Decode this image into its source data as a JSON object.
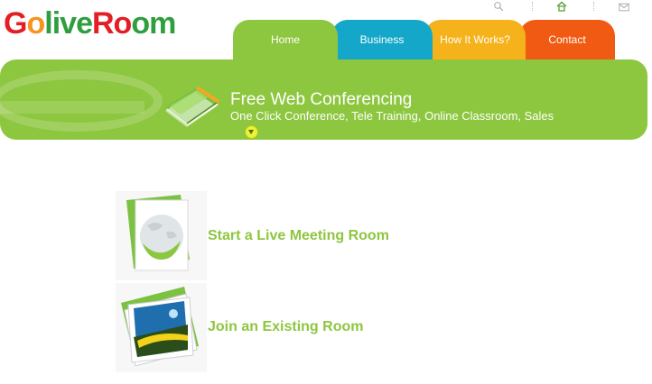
{
  "brand": {
    "logo_letters": [
      {
        "ch": "G",
        "color": "#e31e24"
      },
      {
        "ch": "o",
        "color": "#f7931e"
      },
      {
        "ch": "l",
        "color": "#2e9e3e"
      },
      {
        "ch": "i",
        "color": "#2e9e3e"
      },
      {
        "ch": "v",
        "color": "#2e9e3e"
      },
      {
        "ch": "e",
        "color": "#2e9e3e"
      },
      {
        "ch": "R",
        "color": "#e31e24"
      },
      {
        "ch": "o",
        "color": "#e31e24"
      },
      {
        "ch": "o",
        "color": "#2e9e3e"
      },
      {
        "ch": "m",
        "color": "#2e9e3e"
      }
    ]
  },
  "utility_icons": [
    "search-icon",
    "home-icon",
    "mail-icon"
  ],
  "nav": {
    "tabs": [
      {
        "label": "Home",
        "color": "#8dc63f"
      },
      {
        "label": "Business",
        "color": "#15a7c9"
      },
      {
        "label": "How It Works?",
        "color": "#f6b21a"
      },
      {
        "label": "Contact",
        "color": "#f15a12"
      }
    ]
  },
  "banner": {
    "title": "Free Web Conferencing",
    "subtitle": "One Click Conference, Tele Training, Online Classroom, Sales",
    "color": "#8dc63f"
  },
  "actions": {
    "start_label": "Start a Live Meeting Room",
    "join_label": "Join an Existing Room",
    "color": "#8dc63f"
  }
}
